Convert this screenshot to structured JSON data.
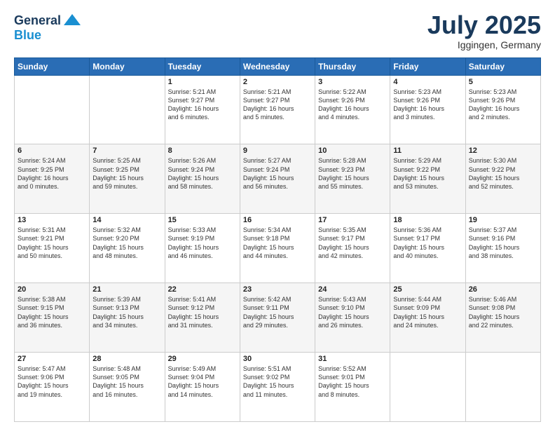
{
  "header": {
    "logo_line1": "General",
    "logo_line2": "Blue",
    "month": "July 2025",
    "location": "Iggingen, Germany"
  },
  "weekdays": [
    "Sunday",
    "Monday",
    "Tuesday",
    "Wednesday",
    "Thursday",
    "Friday",
    "Saturday"
  ],
  "weeks": [
    [
      {
        "day": "",
        "info": ""
      },
      {
        "day": "",
        "info": ""
      },
      {
        "day": "1",
        "info": "Sunrise: 5:21 AM\nSunset: 9:27 PM\nDaylight: 16 hours\nand 6 minutes."
      },
      {
        "day": "2",
        "info": "Sunrise: 5:21 AM\nSunset: 9:27 PM\nDaylight: 16 hours\nand 5 minutes."
      },
      {
        "day": "3",
        "info": "Sunrise: 5:22 AM\nSunset: 9:26 PM\nDaylight: 16 hours\nand 4 minutes."
      },
      {
        "day": "4",
        "info": "Sunrise: 5:23 AM\nSunset: 9:26 PM\nDaylight: 16 hours\nand 3 minutes."
      },
      {
        "day": "5",
        "info": "Sunrise: 5:23 AM\nSunset: 9:26 PM\nDaylight: 16 hours\nand 2 minutes."
      }
    ],
    [
      {
        "day": "6",
        "info": "Sunrise: 5:24 AM\nSunset: 9:25 PM\nDaylight: 16 hours\nand 0 minutes."
      },
      {
        "day": "7",
        "info": "Sunrise: 5:25 AM\nSunset: 9:25 PM\nDaylight: 15 hours\nand 59 minutes."
      },
      {
        "day": "8",
        "info": "Sunrise: 5:26 AM\nSunset: 9:24 PM\nDaylight: 15 hours\nand 58 minutes."
      },
      {
        "day": "9",
        "info": "Sunrise: 5:27 AM\nSunset: 9:24 PM\nDaylight: 15 hours\nand 56 minutes."
      },
      {
        "day": "10",
        "info": "Sunrise: 5:28 AM\nSunset: 9:23 PM\nDaylight: 15 hours\nand 55 minutes."
      },
      {
        "day": "11",
        "info": "Sunrise: 5:29 AM\nSunset: 9:22 PM\nDaylight: 15 hours\nand 53 minutes."
      },
      {
        "day": "12",
        "info": "Sunrise: 5:30 AM\nSunset: 9:22 PM\nDaylight: 15 hours\nand 52 minutes."
      }
    ],
    [
      {
        "day": "13",
        "info": "Sunrise: 5:31 AM\nSunset: 9:21 PM\nDaylight: 15 hours\nand 50 minutes."
      },
      {
        "day": "14",
        "info": "Sunrise: 5:32 AM\nSunset: 9:20 PM\nDaylight: 15 hours\nand 48 minutes."
      },
      {
        "day": "15",
        "info": "Sunrise: 5:33 AM\nSunset: 9:19 PM\nDaylight: 15 hours\nand 46 minutes."
      },
      {
        "day": "16",
        "info": "Sunrise: 5:34 AM\nSunset: 9:18 PM\nDaylight: 15 hours\nand 44 minutes."
      },
      {
        "day": "17",
        "info": "Sunrise: 5:35 AM\nSunset: 9:17 PM\nDaylight: 15 hours\nand 42 minutes."
      },
      {
        "day": "18",
        "info": "Sunrise: 5:36 AM\nSunset: 9:17 PM\nDaylight: 15 hours\nand 40 minutes."
      },
      {
        "day": "19",
        "info": "Sunrise: 5:37 AM\nSunset: 9:16 PM\nDaylight: 15 hours\nand 38 minutes."
      }
    ],
    [
      {
        "day": "20",
        "info": "Sunrise: 5:38 AM\nSunset: 9:15 PM\nDaylight: 15 hours\nand 36 minutes."
      },
      {
        "day": "21",
        "info": "Sunrise: 5:39 AM\nSunset: 9:13 PM\nDaylight: 15 hours\nand 34 minutes."
      },
      {
        "day": "22",
        "info": "Sunrise: 5:41 AM\nSunset: 9:12 PM\nDaylight: 15 hours\nand 31 minutes."
      },
      {
        "day": "23",
        "info": "Sunrise: 5:42 AM\nSunset: 9:11 PM\nDaylight: 15 hours\nand 29 minutes."
      },
      {
        "day": "24",
        "info": "Sunrise: 5:43 AM\nSunset: 9:10 PM\nDaylight: 15 hours\nand 26 minutes."
      },
      {
        "day": "25",
        "info": "Sunrise: 5:44 AM\nSunset: 9:09 PM\nDaylight: 15 hours\nand 24 minutes."
      },
      {
        "day": "26",
        "info": "Sunrise: 5:46 AM\nSunset: 9:08 PM\nDaylight: 15 hours\nand 22 minutes."
      }
    ],
    [
      {
        "day": "27",
        "info": "Sunrise: 5:47 AM\nSunset: 9:06 PM\nDaylight: 15 hours\nand 19 minutes."
      },
      {
        "day": "28",
        "info": "Sunrise: 5:48 AM\nSunset: 9:05 PM\nDaylight: 15 hours\nand 16 minutes."
      },
      {
        "day": "29",
        "info": "Sunrise: 5:49 AM\nSunset: 9:04 PM\nDaylight: 15 hours\nand 14 minutes."
      },
      {
        "day": "30",
        "info": "Sunrise: 5:51 AM\nSunset: 9:02 PM\nDaylight: 15 hours\nand 11 minutes."
      },
      {
        "day": "31",
        "info": "Sunrise: 5:52 AM\nSunset: 9:01 PM\nDaylight: 15 hours\nand 8 minutes."
      },
      {
        "day": "",
        "info": ""
      },
      {
        "day": "",
        "info": ""
      }
    ]
  ]
}
